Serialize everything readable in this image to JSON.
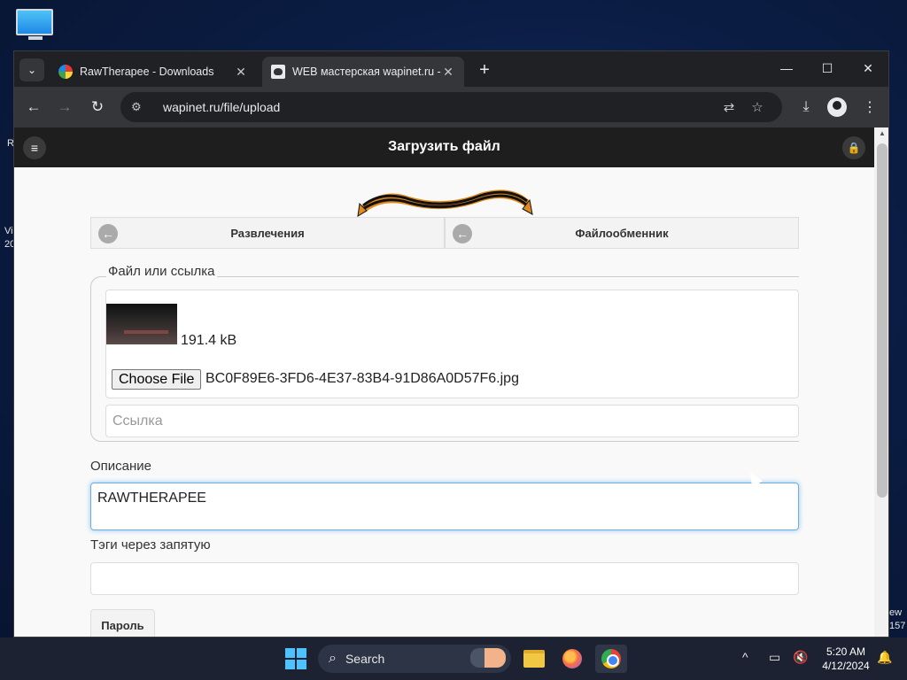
{
  "desktop": {
    "edge_texts": [
      "R",
      "Vi",
      "20",
      "ew",
      "157"
    ]
  },
  "browser": {
    "tabs": [
      {
        "title": "RawTherapee - Downloads",
        "active": false
      },
      {
        "title": "WEB мастерская wapinet.ru - З",
        "active": true
      }
    ],
    "url": "wapinet.ru/file/upload"
  },
  "page": {
    "header_title": "Загрузить файл",
    "breadcrumbs": [
      "Развлечения",
      "Файлообменник"
    ],
    "file_section": {
      "legend": "Файл или ссылка",
      "file_size": "191.4 kB",
      "choose_button": "Choose File",
      "file_name": "BC0F89E6-3FD6-4E37-83B4-91D86A0D57F6.jpg",
      "link_placeholder": "Ссылка"
    },
    "description": {
      "label": "Описание",
      "value": "RAWTHERAPEE"
    },
    "tags": {
      "label": "Тэги через запятую",
      "value": ""
    },
    "password_button": "Пароль"
  },
  "taskbar": {
    "search_label": "Search",
    "time": "5:20 AM",
    "date": "4/12/2024"
  },
  "colors": {
    "accent_focus": "#6ab0e6",
    "header_bg": "#1e1e1e",
    "taskbar_bg": "#1c2232"
  }
}
